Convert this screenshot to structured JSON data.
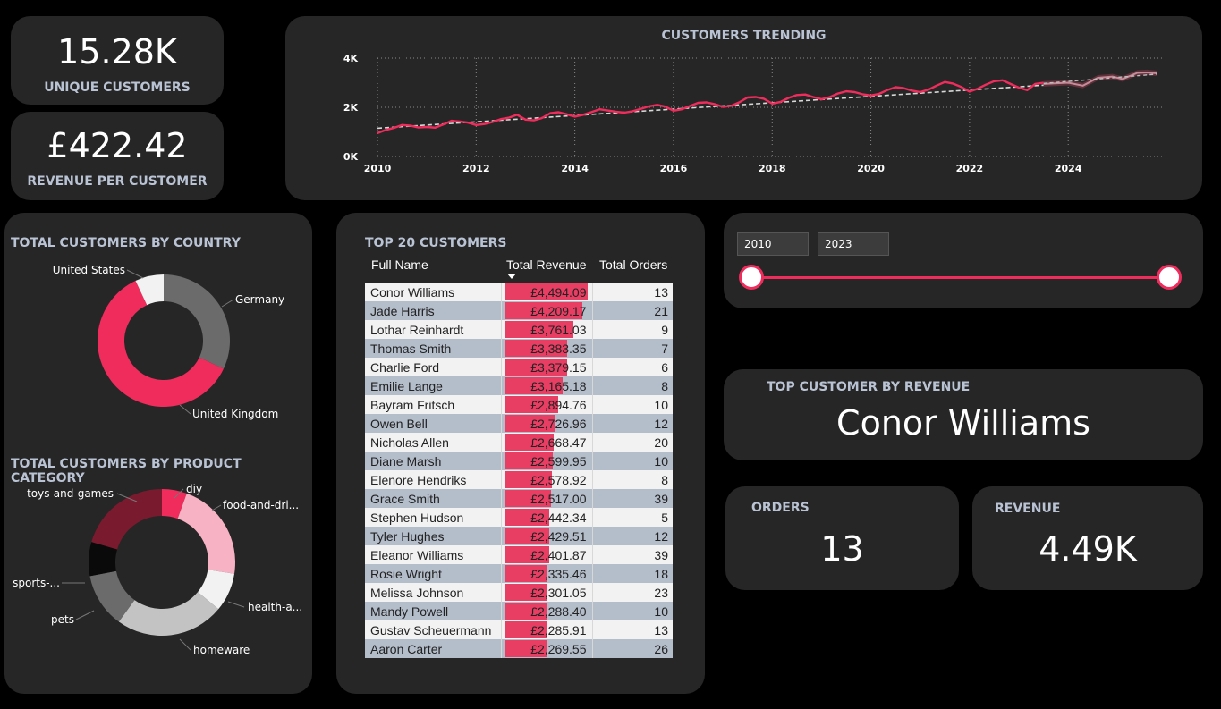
{
  "kpi_unique": {
    "value": "15.28K",
    "label": "UNIQUE CUSTOMERS"
  },
  "kpi_rpc": {
    "value": "£422.42",
    "label": "REVENUE PER CUSTOMER"
  },
  "trend": {
    "title": "CUSTOMERS TRENDING",
    "y_ticks": [
      "4K",
      "2K",
      "0K"
    ],
    "x_ticks": [
      "2010",
      "2012",
      "2014",
      "2016",
      "2018",
      "2020",
      "2022",
      "2024"
    ]
  },
  "chart_data": [
    {
      "type": "line",
      "title": "CUSTOMERS TRENDING",
      "ylim": [
        0,
        4000
      ],
      "x_range": [
        2010,
        2025.9
      ],
      "series": [
        {
          "values": [
            [
              2010.0,
              950
            ],
            [
              2010.17,
              1080
            ],
            [
              2010.33,
              1160
            ],
            [
              2010.5,
              1280
            ],
            [
              2010.67,
              1250
            ],
            [
              2010.83,
              1180
            ],
            [
              2011.0,
              1200
            ],
            [
              2011.17,
              1170
            ],
            [
              2011.33,
              1300
            ],
            [
              2011.5,
              1450
            ],
            [
              2011.67,
              1420
            ],
            [
              2011.83,
              1380
            ],
            [
              2012.0,
              1280
            ],
            [
              2012.17,
              1320
            ],
            [
              2012.33,
              1400
            ],
            [
              2012.5,
              1520
            ],
            [
              2012.67,
              1580
            ],
            [
              2012.83,
              1700
            ],
            [
              2013.0,
              1500
            ],
            [
              2013.17,
              1470
            ],
            [
              2013.33,
              1560
            ],
            [
              2013.5,
              1760
            ],
            [
              2013.67,
              1800
            ],
            [
              2013.83,
              1720
            ],
            [
              2014.0,
              1620
            ],
            [
              2014.17,
              1700
            ],
            [
              2014.33,
              1800
            ],
            [
              2014.5,
              1920
            ],
            [
              2014.67,
              1870
            ],
            [
              2014.83,
              1820
            ],
            [
              2015.0,
              1780
            ],
            [
              2015.17,
              1840
            ],
            [
              2015.33,
              1930
            ],
            [
              2015.5,
              2040
            ],
            [
              2015.67,
              2100
            ],
            [
              2015.83,
              2030
            ],
            [
              2016.0,
              1860
            ],
            [
              2016.17,
              1920
            ],
            [
              2016.33,
              2050
            ],
            [
              2016.5,
              2180
            ],
            [
              2016.67,
              2200
            ],
            [
              2016.83,
              2130
            ],
            [
              2017.0,
              2020
            ],
            [
              2017.17,
              2060
            ],
            [
              2017.33,
              2200
            ],
            [
              2017.5,
              2400
            ],
            [
              2017.67,
              2420
            ],
            [
              2017.83,
              2350
            ],
            [
              2018.0,
              2150
            ],
            [
              2018.17,
              2220
            ],
            [
              2018.33,
              2380
            ],
            [
              2018.5,
              2500
            ],
            [
              2018.67,
              2520
            ],
            [
              2018.83,
              2420
            ],
            [
              2019.0,
              2330
            ],
            [
              2019.17,
              2420
            ],
            [
              2019.33,
              2560
            ],
            [
              2019.5,
              2650
            ],
            [
              2019.67,
              2620
            ],
            [
              2019.83,
              2530
            ],
            [
              2020.0,
              2480
            ],
            [
              2020.17,
              2550
            ],
            [
              2020.33,
              2700
            ],
            [
              2020.5,
              2820
            ],
            [
              2020.67,
              2780
            ],
            [
              2020.83,
              2680
            ],
            [
              2021.0,
              2620
            ],
            [
              2021.17,
              2720
            ],
            [
              2021.33,
              2880
            ],
            [
              2021.5,
              3030
            ],
            [
              2021.67,
              2960
            ],
            [
              2021.83,
              2830
            ],
            [
              2022.0,
              2640
            ],
            [
              2022.17,
              2760
            ],
            [
              2022.33,
              2920
            ],
            [
              2022.5,
              3060
            ],
            [
              2022.67,
              3100
            ],
            [
              2022.83,
              2950
            ],
            [
              2023.0,
              2800
            ],
            [
              2023.17,
              2700
            ],
            [
              2023.33,
              2950
            ],
            [
              2023.5,
              3000
            ]
          ]
        },
        {
          "values": [
            [
              2010.0,
              1150
            ],
            [
              2023.5,
              2900
            ]
          ]
        },
        {
          "values": [
            [
              2023.5,
              2950
            ],
            [
              2024.0,
              3000
            ],
            [
              2024.3,
              2880
            ],
            [
              2024.6,
              3200
            ],
            [
              2024.9,
              3250
            ],
            [
              2025.1,
              3150
            ],
            [
              2025.4,
              3400
            ],
            [
              2025.6,
              3420
            ],
            [
              2025.8,
              3380
            ]
          ]
        },
        {
          "values": [
            [
              2023.5,
              2970
            ],
            [
              2025.8,
              3350
            ]
          ]
        }
      ]
    },
    {
      "type": "pie",
      "title": "TOTAL CUSTOMERS BY COUNTRY",
      "categories": [
        "United Kingdom",
        "Germany",
        "United States"
      ],
      "values": [
        0.61,
        0.32,
        0.07
      ]
    },
    {
      "type": "pie",
      "title": "TOTAL CUSTOMERS BY PRODUCT CATEGORY",
      "categories": [
        "diy",
        "food-and-dri...",
        "health-a...",
        "homeware",
        "pets",
        "sports-...",
        "toys-and-games"
      ],
      "values": [
        0.055,
        0.22,
        0.085,
        0.24,
        0.12,
        0.075,
        0.205
      ]
    }
  ],
  "country": {
    "title": "TOTAL CUSTOMERS BY COUNTRY",
    "labels": [
      "United States",
      "Germany",
      "United Kingdom"
    ],
    "colors": [
      "#f2f2f2",
      "#6b6b6b",
      "#ef2c5c"
    ]
  },
  "category": {
    "title": "TOTAL CUSTOMERS BY PRODUCT CATEGORY",
    "labels": [
      "toys-and-games",
      "diy",
      "food-and-dri...",
      "sports-...",
      "health-a...",
      "pets",
      "homeware"
    ],
    "colors": [
      "#ef2c5c",
      "#f7b2c4",
      "#f2f2f2",
      "#c3c3c3",
      "#6b6b6b",
      "#0a0a0a",
      "#7a1a2e"
    ]
  },
  "top": {
    "title": "TOP 20 CUSTOMERS",
    "headers": [
      "Full Name",
      "Total Revenue",
      "Total Orders"
    ],
    "rows": [
      {
        "name": "Conor Williams",
        "revenue": "£4,494.09",
        "orders": "13",
        "rev_value": 4494.09
      },
      {
        "name": "Jade Harris",
        "revenue": "£4,209.17",
        "orders": "21",
        "rev_value": 4209.17
      },
      {
        "name": "Lothar Reinhardt",
        "revenue": "£3,761.03",
        "orders": "9",
        "rev_value": 3761.03
      },
      {
        "name": "Thomas Smith",
        "revenue": "£3,383.35",
        "orders": "7",
        "rev_value": 3383.35
      },
      {
        "name": "Charlie Ford",
        "revenue": "£3,379.15",
        "orders": "6",
        "rev_value": 3379.15
      },
      {
        "name": "Emilie Lange",
        "revenue": "£3,165.18",
        "orders": "8",
        "rev_value": 3165.18
      },
      {
        "name": "Bayram Fritsch",
        "revenue": "£2,894.76",
        "orders": "10",
        "rev_value": 2894.76
      },
      {
        "name": "Owen Bell",
        "revenue": "£2,726.96",
        "orders": "12",
        "rev_value": 2726.96
      },
      {
        "name": "Nicholas Allen",
        "revenue": "£2,668.47",
        "orders": "20",
        "rev_value": 2668.47
      },
      {
        "name": "Diane Marsh",
        "revenue": "£2,599.95",
        "orders": "10",
        "rev_value": 2599.95
      },
      {
        "name": "Elenore Hendriks",
        "revenue": "£2,578.92",
        "orders": "8",
        "rev_value": 2578.92
      },
      {
        "name": "Grace Smith",
        "revenue": "£2,517.00",
        "orders": "39",
        "rev_value": 2517.0
      },
      {
        "name": "Stephen Hudson",
        "revenue": "£2,442.34",
        "orders": "5",
        "rev_value": 2442.34
      },
      {
        "name": "Tyler Hughes",
        "revenue": "£2,429.51",
        "orders": "12",
        "rev_value": 2429.51
      },
      {
        "name": "Eleanor Williams",
        "revenue": "£2,401.87",
        "orders": "39",
        "rev_value": 2401.87
      },
      {
        "name": "Rosie Wright",
        "revenue": "£2,335.46",
        "orders": "18",
        "rev_value": 2335.46
      },
      {
        "name": "Melissa Johnson",
        "revenue": "£2,301.05",
        "orders": "23",
        "rev_value": 2301.05
      },
      {
        "name": "Mandy Powell",
        "revenue": "£2,288.40",
        "orders": "10",
        "rev_value": 2288.4
      },
      {
        "name": "Gustav Scheuermann",
        "revenue": "£2,285.91",
        "orders": "13",
        "rev_value": 2285.91
      },
      {
        "name": "Aaron Carter",
        "revenue": "£2,269.55",
        "orders": "26",
        "rev_value": 2269.55
      }
    ]
  },
  "slicer": {
    "start": "2010",
    "end": "2023"
  },
  "top_customer": {
    "label": "TOP CUSTOMER BY REVENUE",
    "name": "Conor Williams"
  },
  "orders": {
    "label": "ORDERS",
    "value": "13"
  },
  "revenue": {
    "label": "REVENUE",
    "value": "4.49K"
  },
  "colors": {
    "accent": "#ef2c5c",
    "card": "#262626",
    "label": "#b9c3d4"
  }
}
